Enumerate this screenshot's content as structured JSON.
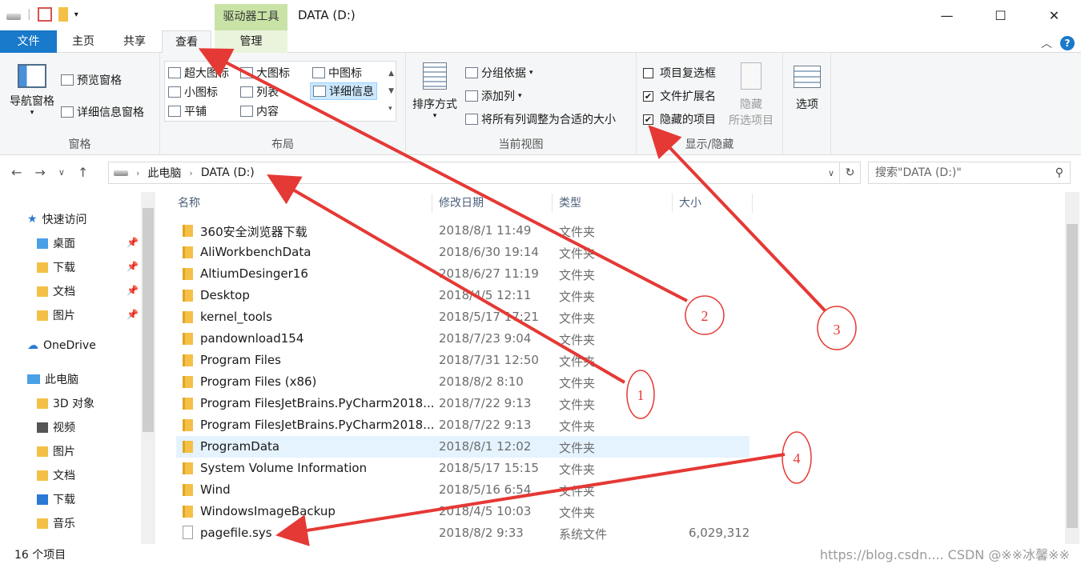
{
  "window": {
    "title": "DATA (D:)",
    "context_tab_header": "驱动器工具",
    "minimize": "—",
    "maximize": "☐",
    "close": "✕"
  },
  "ribbon_tabs": [
    {
      "label": "文件"
    },
    {
      "label": "主页"
    },
    {
      "label": "共享"
    },
    {
      "label": "查看"
    },
    {
      "label": "管理"
    }
  ],
  "ribbon": {
    "panes": {
      "nav_pane": "导航窗格",
      "preview_pane": "预览窗格",
      "details_pane": "详细信息窗格",
      "group_label": "窗格"
    },
    "layout": {
      "items": [
        "超大图标",
        "大图标",
        "中图标",
        "小图标",
        "列表",
        "详细信息",
        "平铺",
        "内容"
      ],
      "group_label": "布局"
    },
    "current_view": {
      "sort_by": "排序方式",
      "group_by": "分组依据",
      "add_column": "添加列",
      "fit_columns": "将所有列调整为合适的大小",
      "group_label": "当前视图"
    },
    "show_hide": {
      "item_checkboxes": {
        "label": "项目复选框",
        "checked": false
      },
      "file_extensions": {
        "label": "文件扩展名",
        "checked": true
      },
      "hidden_items": {
        "label": "隐藏的项目",
        "checked": true
      },
      "hide_selected_1": "隐藏",
      "hide_selected_2": "所选项目",
      "group_label": "显示/隐藏"
    },
    "options": "选项"
  },
  "address": {
    "path": [
      "此电脑",
      "DATA (D:)"
    ],
    "search_placeholder": "搜索\"DATA (D:)\""
  },
  "nav_pane": {
    "quick_access": "快速访问",
    "quick_items": [
      "桌面",
      "下载",
      "文档",
      "图片"
    ],
    "onedrive": "OneDrive",
    "this_pc": "此电脑",
    "pc_items": [
      "3D 对象",
      "视频",
      "图片",
      "文档",
      "下载",
      "音乐"
    ]
  },
  "columns": {
    "name": "名称",
    "modified": "修改日期",
    "type": "类型",
    "size": "大小"
  },
  "files": [
    {
      "name": "360安全浏览器下载",
      "date": "2018/8/1 11:49",
      "type": "文件夹",
      "size": ""
    },
    {
      "name": "AliWorkbenchData",
      "date": "2018/6/30 19:14",
      "type": "文件夹",
      "size": ""
    },
    {
      "name": "AltiumDesinger16",
      "date": "2018/6/27 11:19",
      "type": "文件夹",
      "size": ""
    },
    {
      "name": "Desktop",
      "date": "2018/4/5 12:11",
      "type": "文件夹",
      "size": ""
    },
    {
      "name": "kernel_tools",
      "date": "2018/5/17 17:21",
      "type": "文件夹",
      "size": ""
    },
    {
      "name": "pandownload154",
      "date": "2018/7/23 9:04",
      "type": "文件夹",
      "size": ""
    },
    {
      "name": "Program Files",
      "date": "2018/7/31 12:50",
      "type": "文件夹",
      "size": ""
    },
    {
      "name": "Program Files (x86)",
      "date": "2018/8/2 8:10",
      "type": "文件夹",
      "size": ""
    },
    {
      "name": "Program FilesJetBrains.PyCharm2018...",
      "date": "2018/7/22 9:13",
      "type": "文件夹",
      "size": ""
    },
    {
      "name": "Program FilesJetBrains.PyCharm2018...",
      "date": "2018/7/22 9:13",
      "type": "文件夹",
      "size": ""
    },
    {
      "name": "ProgramData",
      "date": "2018/8/1 12:02",
      "type": "文件夹",
      "size": ""
    },
    {
      "name": "System Volume Information",
      "date": "2018/5/17 15:15",
      "type": "文件夹",
      "size": ""
    },
    {
      "name": "Wind",
      "date": "2018/5/16 6:54",
      "type": "文件夹",
      "size": ""
    },
    {
      "name": "WindowsImageBackup",
      "date": "2018/4/5 10:03",
      "type": "文件夹",
      "size": ""
    },
    {
      "name": "pagefile.sys",
      "date": "2018/8/2 9:33",
      "type": "系统文件",
      "size": "6,029,312"
    }
  ],
  "status": {
    "count": "16 个项目",
    "watermark": "https://blog.csdn.... CSDN @※※冰馨※※"
  },
  "annotations": [
    "1",
    "2",
    "3",
    "4"
  ],
  "colors": {
    "accent": "#1979ca",
    "context_tab": "#c9e3a7",
    "selection": "#e5f3ff",
    "annotation": "#e53935"
  }
}
